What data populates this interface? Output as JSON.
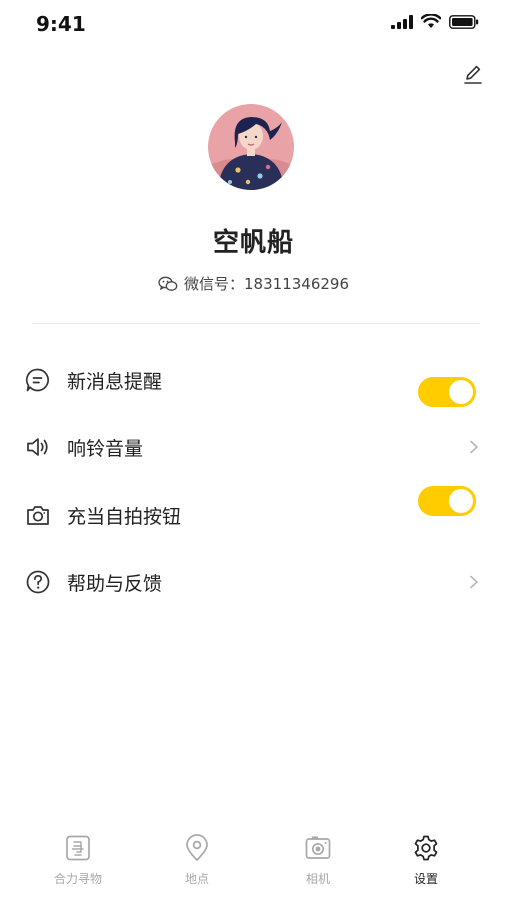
{
  "status_bar": {
    "time": "9:41"
  },
  "profile": {
    "name": "空帆船",
    "wechat_label": "微信号：",
    "wechat_id": "18311346296"
  },
  "settings": [
    {
      "label": "新消息提醒",
      "icon": "message-icon",
      "control": "toggle",
      "on": true
    },
    {
      "label": "响铃音量",
      "icon": "speaker-icon",
      "control": "chevron"
    },
    {
      "label": "充当自拍按钮",
      "icon": "camera-icon",
      "control": "toggle",
      "on": true
    },
    {
      "label": "帮助与反馈",
      "icon": "help-icon",
      "control": "chevron"
    }
  ],
  "tabs": [
    {
      "label": "合力寻物",
      "icon": "find-icon",
      "active": false
    },
    {
      "label": "地点",
      "icon": "location-icon",
      "active": false
    },
    {
      "label": "相机",
      "icon": "camera-icon",
      "active": false
    },
    {
      "label": "设置",
      "icon": "gear-icon",
      "active": true
    }
  ],
  "colors": {
    "accent": "#FFCC00",
    "inactive_tab": "#a8a8a8",
    "active_tab": "#222222"
  }
}
